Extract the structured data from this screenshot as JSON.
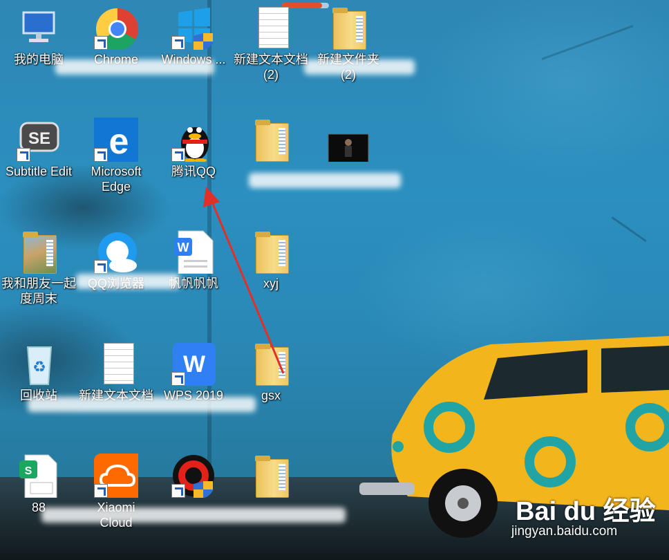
{
  "desktop": {
    "icons": [
      {
        "key": "my-computer",
        "label": "我的电脑",
        "shortcut": false
      },
      {
        "key": "chrome",
        "label": "Chrome",
        "shortcut": true
      },
      {
        "key": "windows",
        "label": "Windows ...",
        "shortcut": true
      },
      {
        "key": "new-text-doc",
        "label": "新建文本文档",
        "label2": "(2)",
        "shortcut": false
      },
      {
        "key": "new-folder-2",
        "label": "新建文件夹",
        "label2": "(2)",
        "shortcut": false
      },
      {
        "key": "subtitle-edit",
        "label": "Subtitle Edit",
        "shortcut": true
      },
      {
        "key": "edge",
        "label": "Microsoft",
        "label2": "Edge",
        "shortcut": true
      },
      {
        "key": "qq",
        "label": "腾讯QQ",
        "shortcut": true
      },
      {
        "key": "folder-blurred",
        "label": "",
        "shortcut": false
      },
      {
        "key": "video-file",
        "label": "",
        "shortcut": false
      },
      {
        "key": "photo-folder",
        "label": "我和朋友一起",
        "label2": "度周末",
        "shortcut": false
      },
      {
        "key": "qq-browser",
        "label": "QQ浏览器",
        "shortcut": true
      },
      {
        "key": "wps-doc",
        "label": "帆帆帆帆",
        "shortcut": false
      },
      {
        "key": "folder-xyj",
        "label": "xyj",
        "shortcut": false
      },
      {
        "key": "recycle-bin",
        "label": "回收站",
        "shortcut": false
      },
      {
        "key": "text-doc",
        "label": "新建文本文档",
        "shortcut": false
      },
      {
        "key": "wps-2019",
        "label": "WPS 2019",
        "shortcut": true
      },
      {
        "key": "folder-gsx",
        "label": "gsx",
        "shortcut": false
      },
      {
        "key": "spreadsheet",
        "label": "88",
        "shortcut": false
      },
      {
        "key": "xiaomi-cloud",
        "label": "Xiaomi",
        "label2": "Cloud",
        "shortcut": true
      },
      {
        "key": "recorder",
        "label": "",
        "shortcut": true
      },
      {
        "key": "folder-115",
        "label": "",
        "shortcut": false
      }
    ]
  },
  "watermark": {
    "brand": "Bai du 经验",
    "url": "jingyan.baidu.com"
  },
  "progress": {
    "value": 0.85
  },
  "colors": {
    "wallpaper": "#2b8fbf",
    "car": "#f2b51c",
    "arrow": "#e0302a"
  }
}
